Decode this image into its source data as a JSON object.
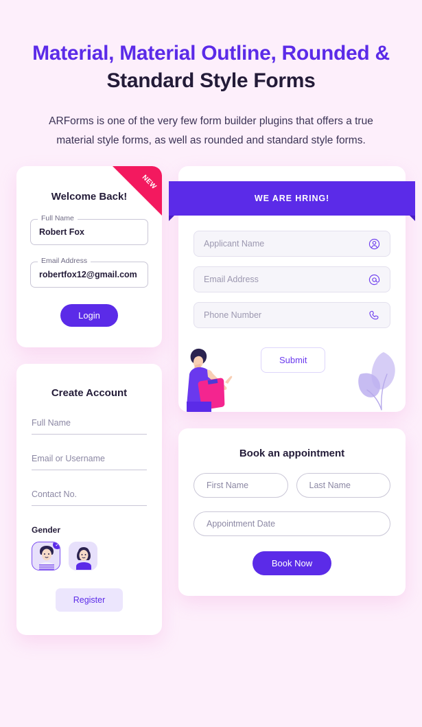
{
  "header": {
    "title_part1": "Material, Material Outline,",
    "title_part2": "Rounded &",
    "title_part3": " Standard Style Forms",
    "subtitle": "ARForms is one of the very few form builder plugins that offers a true material style forms, as well as rounded and standard style forms."
  },
  "colors": {
    "background": "#fdeffb",
    "accent": "#5b2be8",
    "ribbon_new": "#f3195f",
    "text_dark": "#231b38",
    "placeholder": "#8b87a3"
  },
  "login_card": {
    "title": "Welcome Back!",
    "ribbon_badge": "NEW",
    "fields": [
      {
        "label": "Full Name",
        "value": "Robert Fox"
      },
      {
        "label": "Email Address",
        "value": "robertfox12@gmail.com"
      }
    ],
    "submit_label": "Login"
  },
  "register_card": {
    "title": "Create Account",
    "fields": [
      {
        "placeholder": "Full Name"
      },
      {
        "placeholder": "Email or Username"
      },
      {
        "placeholder": "Contact No."
      }
    ],
    "gender_label": "Gender",
    "gender_options": [
      {
        "name": "male-avatar",
        "selected": true,
        "check_glyph": "✓"
      },
      {
        "name": "female-avatar",
        "selected": false,
        "check_glyph": ""
      }
    ],
    "submit_label": "Register"
  },
  "hiring_card": {
    "banner": "WE ARE HRING!",
    "fields": [
      {
        "placeholder": "Applicant Name",
        "icon": "user-circle-icon"
      },
      {
        "placeholder": "Email Address",
        "icon": "at-sign-icon"
      },
      {
        "placeholder": "Phone Number",
        "icon": "phone-icon"
      }
    ],
    "submit_label": "Submit"
  },
  "appointment_card": {
    "title": "Book an appointment",
    "fields": [
      {
        "placeholder": "First Name"
      },
      {
        "placeholder": "Last Name"
      },
      {
        "placeholder": "Appointment Date"
      }
    ],
    "submit_label": "Book Now"
  }
}
